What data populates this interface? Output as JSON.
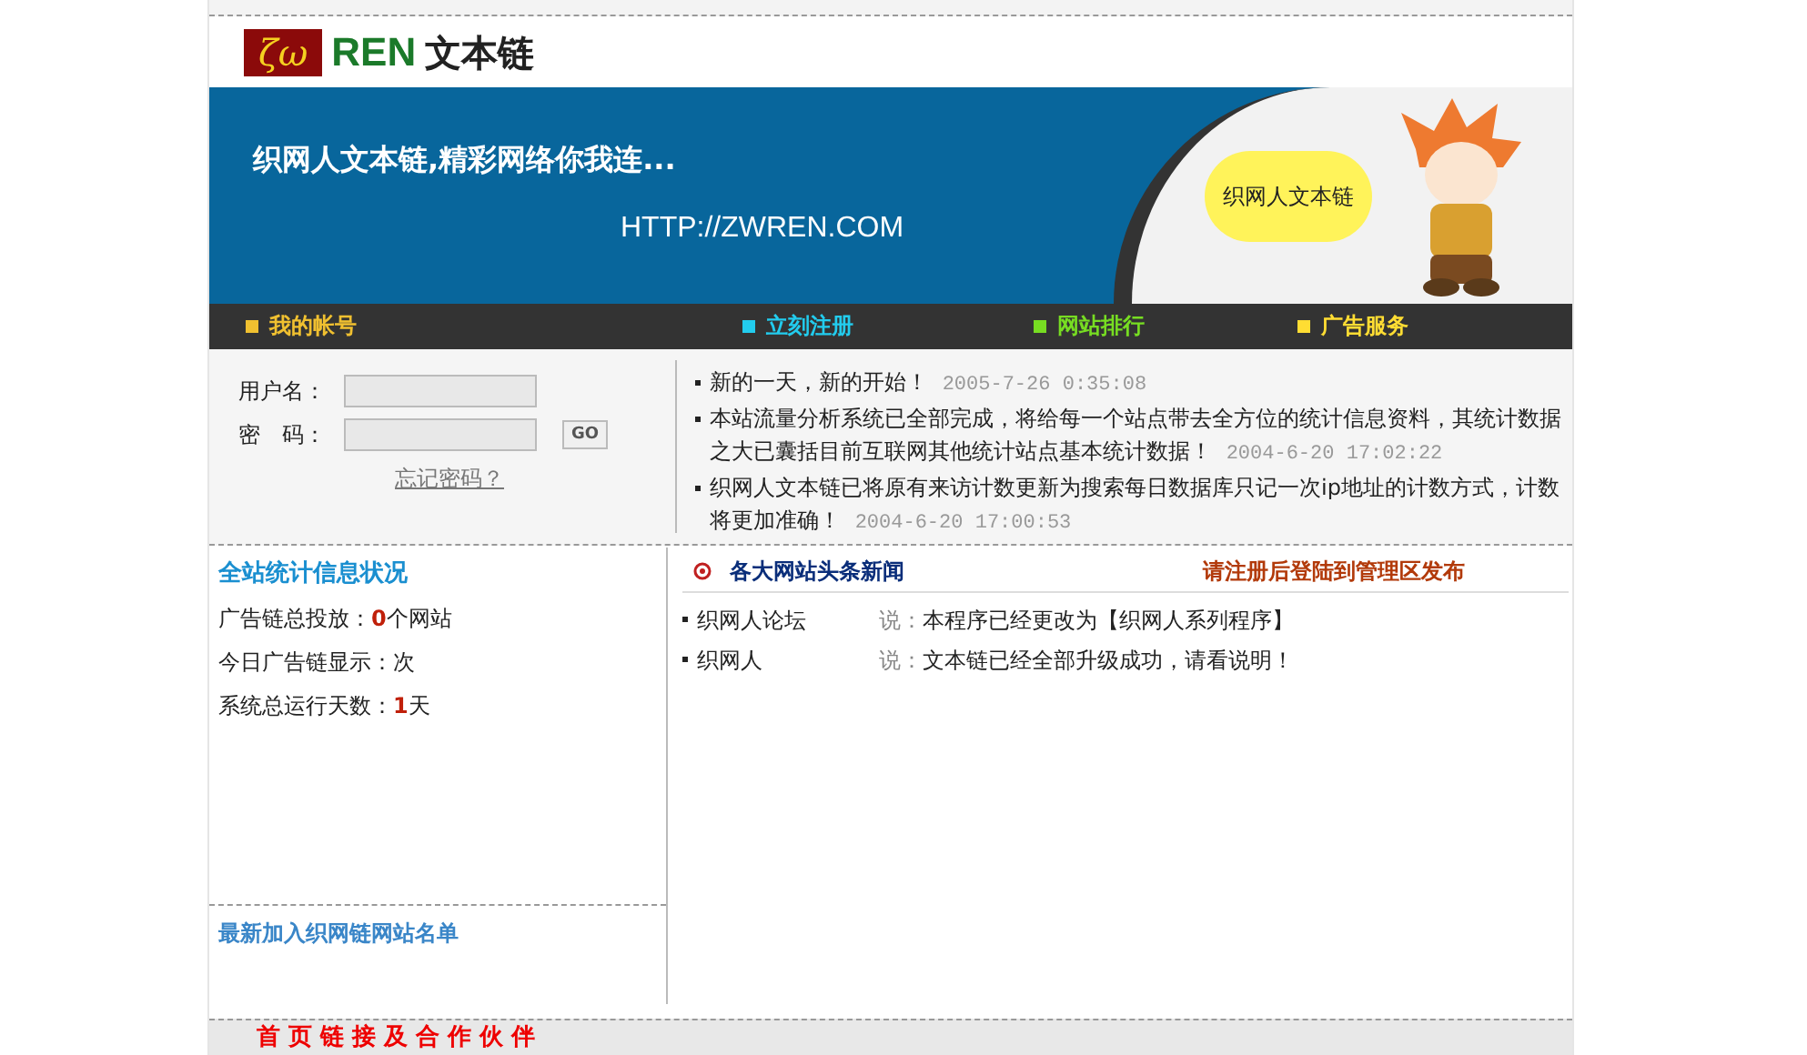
{
  "logo": {
    "mark": "ζω",
    "brand": "REN",
    "name": "文本链"
  },
  "banner": {
    "slogan": "织网人文本链,精彩网络你我连...",
    "url": "HTTP://ZWREN.COM",
    "badge": "织网人文本链"
  },
  "nav": [
    {
      "label": "我的帐号",
      "color": "#f0c030"
    },
    {
      "label": "立刻注册",
      "color": "#22ccee"
    },
    {
      "label": "网站排行",
      "color": "#77dd22"
    },
    {
      "label": "广告服务",
      "color": "#ffdd33"
    }
  ],
  "login": {
    "username_label": "用户名：",
    "password_label": "密　码：",
    "go": "GO",
    "forgot": "忘记密码？"
  },
  "notices": [
    {
      "text": "新的一天，新的开始！",
      "date": "2005-7-26 0:35:08"
    },
    {
      "text": "本站流量分析系统已全部完成，将给每一个站点带去全方位的统计信息资料，其统计数据之大已囊括目前互联网其他统计站点基本统计数据！",
      "date": "2004-6-20 17:02:22"
    },
    {
      "text": "织网人文本链已将原有来访计数更新为搜索每日数据库只记一次ip地址的计数方式，计数将更加准确！",
      "date": "2004-6-20 17:00:53"
    }
  ],
  "stats": {
    "title": "全站统计信息状况",
    "items": [
      {
        "label": "广告链总投放：",
        "value": "0",
        "unit": "个网站"
      },
      {
        "label": "今日广告链显示：",
        "unit": "次"
      },
      {
        "label": "系统总运行天数：",
        "value": "1",
        "unit": "天"
      }
    ]
  },
  "newest": {
    "title": "最新加入织网链网站名单"
  },
  "news": {
    "title": "各大网站头条新闻",
    "notice": "请注册后登陆到管理区发布",
    "items": [
      {
        "source": "织网人论坛",
        "says": "说：",
        "text": "本程序已经更改为【织网人系列程序】"
      },
      {
        "source": "织网人",
        "says": "说：",
        "text": "文本链已经全部升级成功，请看说明！"
      }
    ]
  },
  "footer": {
    "title": "首 页 链 接 及 合 作 伙 伴"
  }
}
